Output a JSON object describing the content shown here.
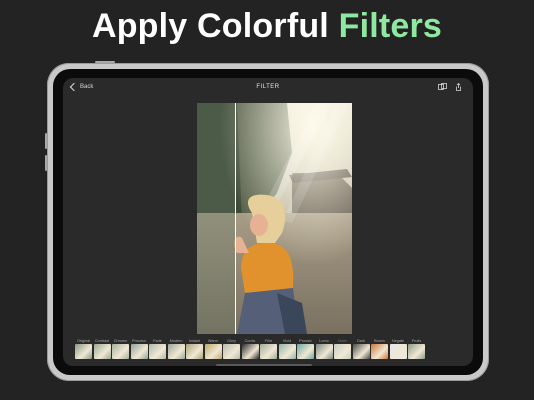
{
  "headline": {
    "part1": "Apply Colorful",
    "part2": "Filters"
  },
  "topbar": {
    "back_label": "Back",
    "title": "FILTER"
  },
  "icons": {
    "back": "chevron-left-icon",
    "compare": "compare-icon",
    "share": "share-icon"
  },
  "colors": {
    "accent": "#8fe8a0",
    "background": "#232323",
    "screen": "#2a2a2a"
  },
  "filters": [
    {
      "label": "Original",
      "color": "#8a9a86"
    },
    {
      "label": "Contrast",
      "color": "#9aa890"
    },
    {
      "label": "Chrome",
      "color": "#a5b29a"
    },
    {
      "label": "Process",
      "color": "#8ea49a"
    },
    {
      "label": "Fade",
      "color": "#b0b8a8"
    },
    {
      "label": "Modern",
      "color": "#9ca698"
    },
    {
      "label": "Instant",
      "color": "#a9a57a"
    },
    {
      "label": "Warm",
      "color": "#c0a868"
    },
    {
      "label": "Glory",
      "color": "#b8bcb0"
    },
    {
      "label": "Comic",
      "color": "#2a2a2a"
    },
    {
      "label": "Film",
      "color": "#a0ad9a"
    },
    {
      "label": "Vivid",
      "color": "#94b4a8"
    },
    {
      "label": "Prosaic",
      "color": "#6aa8a0"
    },
    {
      "label": "Lomo",
      "color": "#7a8a82"
    },
    {
      "label": "Matte",
      "color": "#c8ccc4"
    },
    {
      "label": "Dark",
      "color": "#4a4a44"
    },
    {
      "label": "Brown",
      "color": "#d0783a"
    },
    {
      "label": "Negate",
      "color": "#e8e8e8"
    },
    {
      "label": "Fruits",
      "color": "#8c9c84"
    }
  ],
  "selected_filter_index": 14
}
